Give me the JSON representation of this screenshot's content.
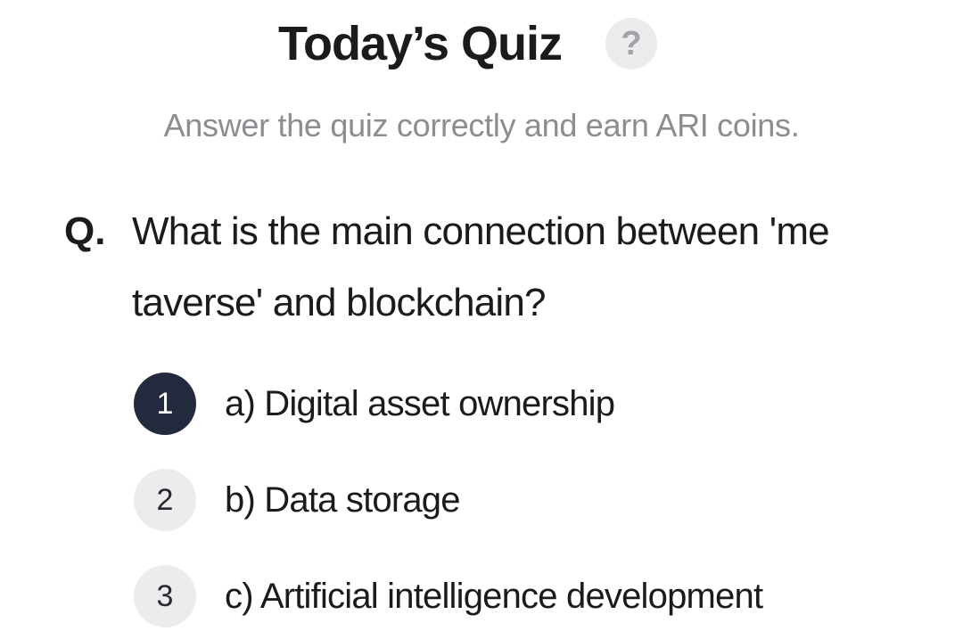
{
  "header": {
    "title": "Today’s Quiz",
    "help_icon_glyph": "?",
    "help_icon": "question-mark-icon"
  },
  "subtitle": "Answer the quiz correctly and earn ARI coins.",
  "question": {
    "prefix": "Q.",
    "text_line1": "What is the main connection between 'me",
    "text_line2": "taverse' and blockchain?"
  },
  "options": [
    {
      "number": "1",
      "label": "a) Digital asset ownership",
      "selected": true
    },
    {
      "number": "2",
      "label": "b) Data storage",
      "selected": false
    },
    {
      "number": "3",
      "label": "c) Artificial intelligence development",
      "selected": false
    }
  ],
  "colors": {
    "selected_circle": "#232a3d",
    "unselected_circle": "#ececee",
    "subtitle_text": "#8c8c91"
  }
}
